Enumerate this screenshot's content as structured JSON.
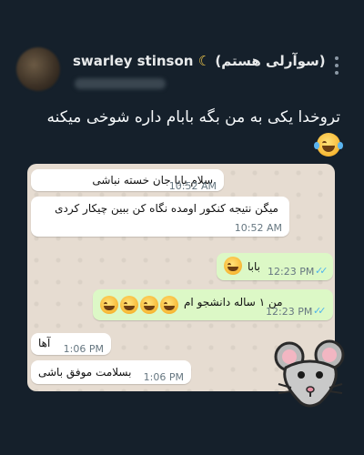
{
  "tweet": {
    "author_name": "swarley stinson",
    "author_suffix": "(سوآرلی هستم)",
    "author_moon": "☾",
    "text": "تروخدا یکی به من بگه بابام داره شوخی میکنه"
  },
  "chat": {
    "messages": [
      {
        "direction": "incoming",
        "text": "سلام بابا جان خسته نباشی",
        "time": "10:52 AM"
      },
      {
        "direction": "incoming",
        "text": "میگن نتیجه کنکور اومده نگاه کن ببین چیکار کردی",
        "time": "10:52 AM"
      },
      {
        "direction": "outgoing",
        "text": "بابا",
        "time": "12:23 PM",
        "status": "read"
      },
      {
        "direction": "outgoing",
        "text": "من ۱ ساله دانشجو ام",
        "time": "12:23 PM",
        "status": "read"
      },
      {
        "direction": "incoming",
        "text": "آها",
        "time": "1:06 PM"
      },
      {
        "direction": "incoming",
        "text": "بسلامت موفق باشی",
        "time": "1:06 PM"
      }
    ],
    "read_color": "#4fb6ec",
    "incoming_color": "#ffffff",
    "outgoing_color": "#dcf8c6"
  },
  "icons": {
    "menu": "more-vertical-icon",
    "emoji": "face-with-tears-of-joy",
    "sticker": "mouse-sticker"
  }
}
